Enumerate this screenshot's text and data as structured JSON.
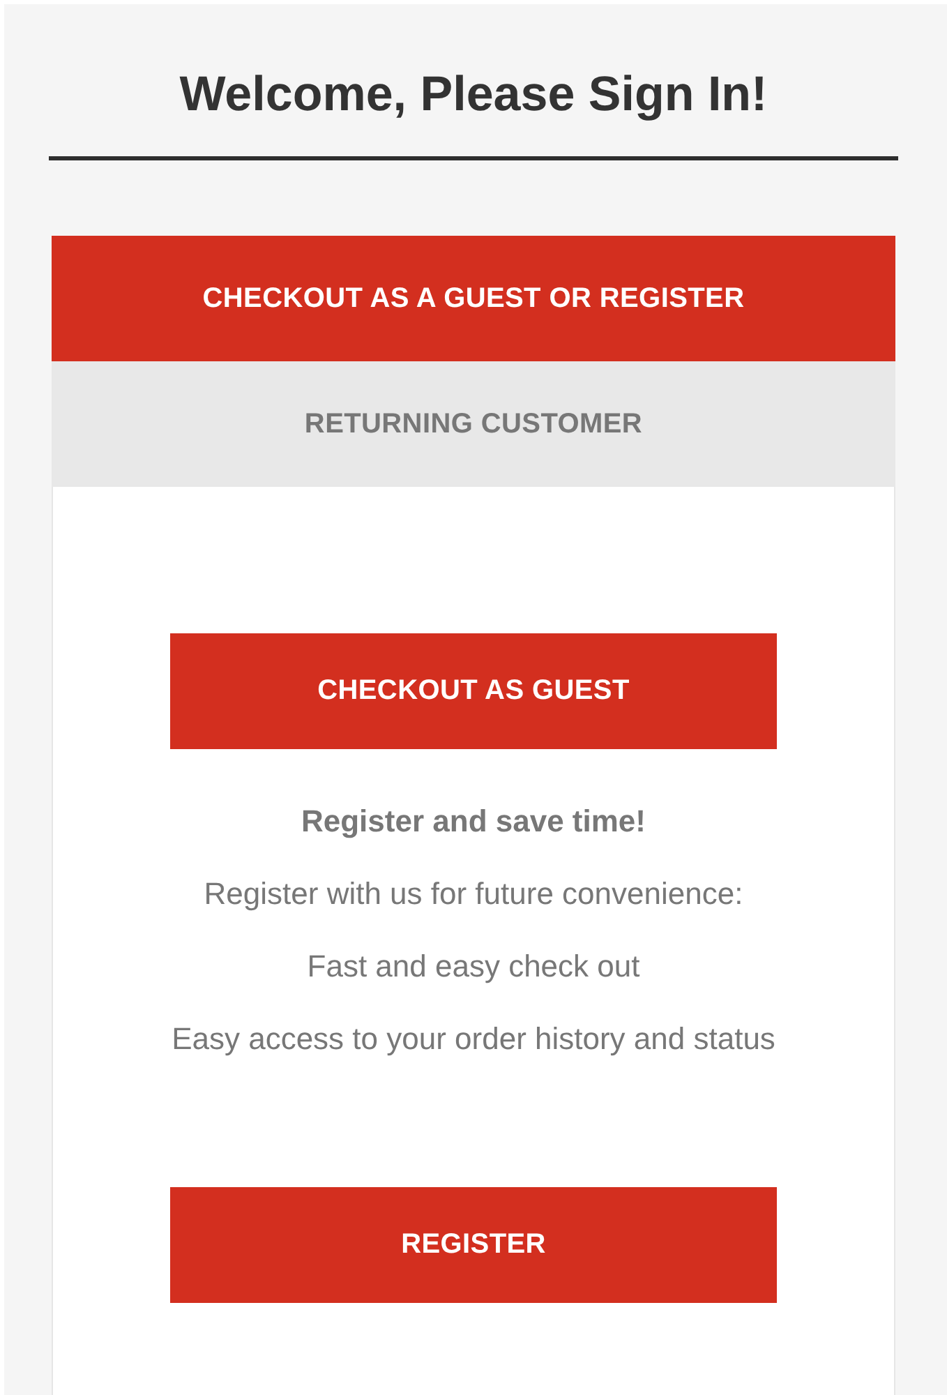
{
  "page": {
    "title": "Welcome, Please Sign In!"
  },
  "tabs": [
    {
      "label": "CHECKOUT AS A GUEST OR REGISTER",
      "selected": true
    },
    {
      "label": "RETURNING CUSTOMER",
      "selected": false
    }
  ],
  "panel": {
    "guest_button": "CHECKOUT AS GUEST",
    "heading": "Register and save time!",
    "lines": [
      "Register with us for future convenience:",
      "Fast and easy check out",
      "Easy access to your order history and status"
    ],
    "register_button": "REGISTER"
  }
}
